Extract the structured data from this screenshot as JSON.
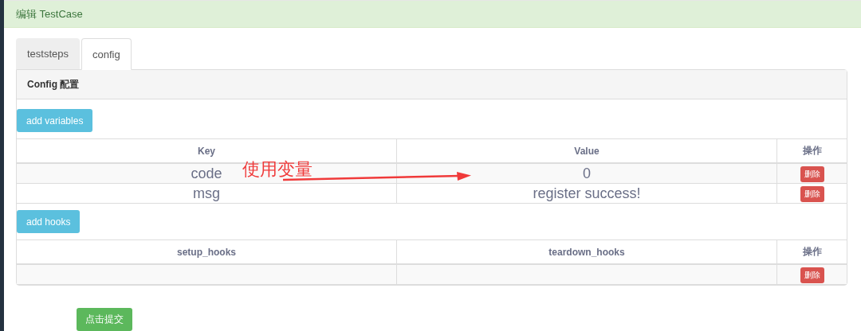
{
  "header": {
    "title": "编辑 TestCase"
  },
  "tabs": [
    {
      "label": "teststeps",
      "selected": false
    },
    {
      "label": "config",
      "selected": true
    }
  ],
  "panel": {
    "title": "Config 配置",
    "variables": {
      "add_button": "add variables",
      "columns": [
        "Key",
        "Value",
        "操作"
      ],
      "rows": [
        {
          "key": "code",
          "value": "0",
          "delete": "删除"
        },
        {
          "key": "msg",
          "value": "register success!",
          "delete": "删除"
        }
      ]
    },
    "hooks": {
      "add_button": "add hooks",
      "columns": [
        "setup_hooks",
        "teardown_hooks",
        "操作"
      ],
      "rows": [
        {
          "setup": "",
          "teardown": "",
          "delete": "删除"
        }
      ]
    }
  },
  "submit_button": "点击提交",
  "annotation": {
    "text": "使用变量"
  }
}
